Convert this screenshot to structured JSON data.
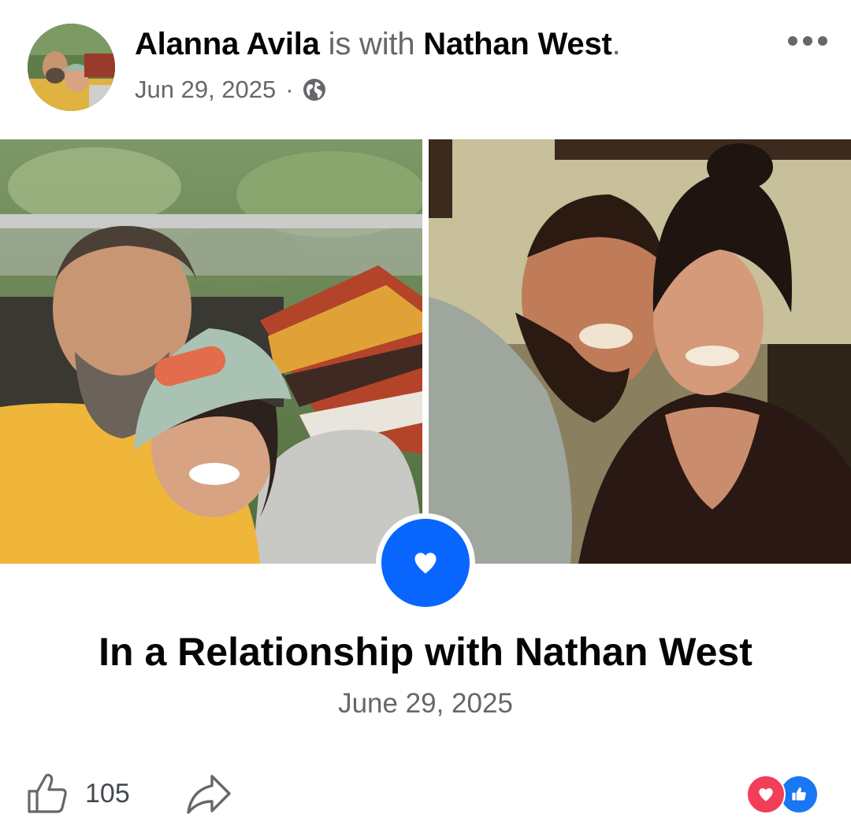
{
  "post": {
    "author": "Alanna Avila",
    "with_text": "is with",
    "tagged": "Nathan West",
    "period": ".",
    "date": "Jun 29, 2025",
    "separator": "·",
    "privacy_icon": "globe-icon",
    "more_icon": "more-options-icon"
  },
  "photos": {
    "left": "selfie-couple-outdoor-photo",
    "right": "couple-indoor-photo"
  },
  "life_event": {
    "icon": "heart-icon",
    "title": "In a Relationship with Nathan West",
    "date": "June 29, 2025"
  },
  "footer": {
    "like_icon": "thumbs-up-icon",
    "like_count": "105",
    "share_icon": "share-arrow-icon",
    "reactions": [
      "love",
      "like"
    ]
  },
  "colors": {
    "accent": "#0866ff",
    "text_primary": "#050505",
    "text_secondary": "#65676b",
    "love": "#f33e58",
    "like": "#1877f2"
  }
}
